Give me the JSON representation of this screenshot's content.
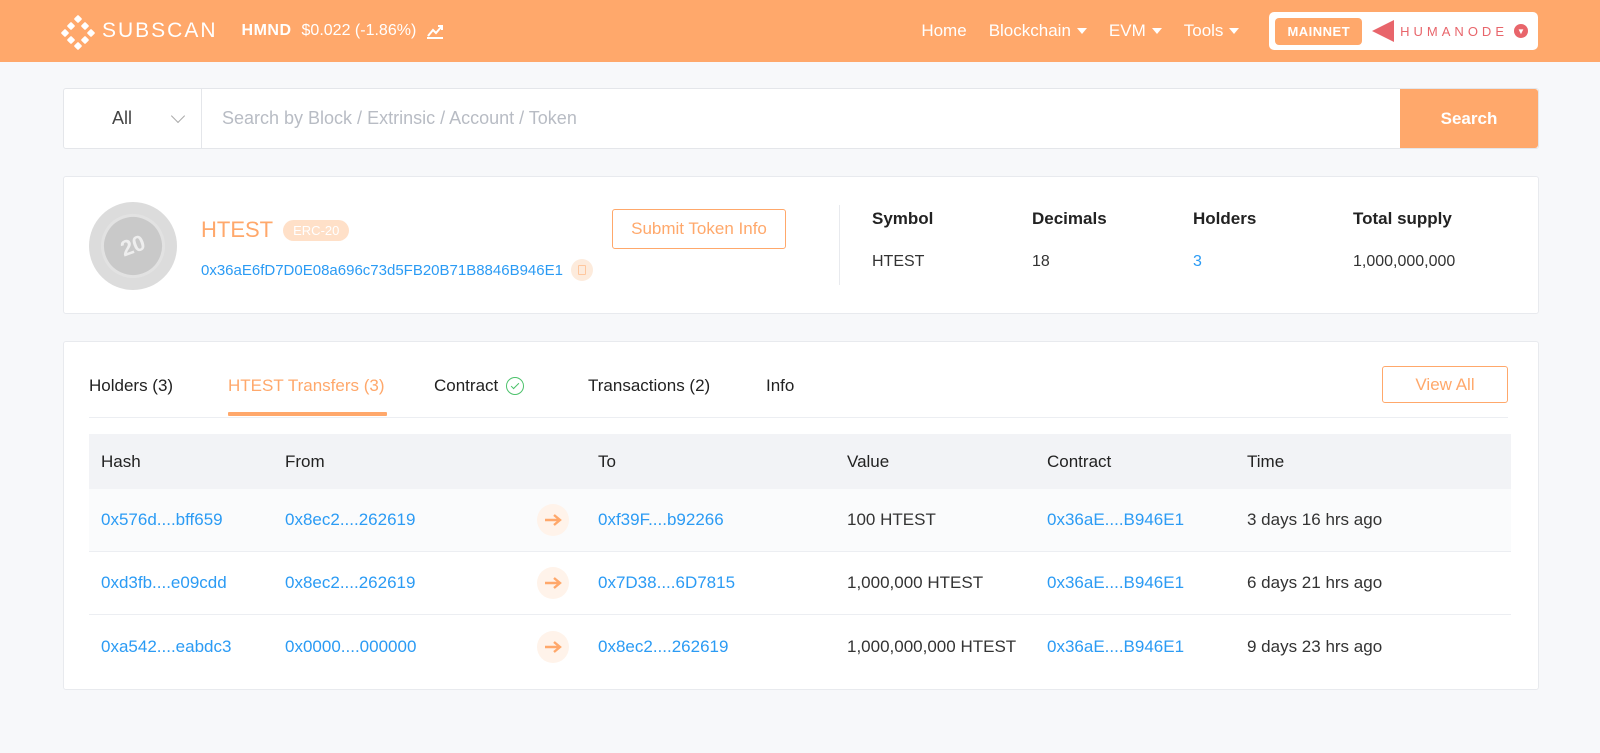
{
  "header": {
    "logo_text": "SUBSCAN",
    "token_symbol": "HMND",
    "token_price": "$0.022 (-1.86%)",
    "nav": [
      {
        "label": "Home"
      },
      {
        "label": "Blockchain"
      },
      {
        "label": "EVM"
      },
      {
        "label": "Tools"
      }
    ],
    "network_badge": "MAINNET",
    "network_name": "HUMANODE",
    "colors": {
      "accent": "#ffa86b",
      "link": "#2b9bf4"
    }
  },
  "search": {
    "select_value": "All",
    "placeholder": "Search by Block / Extrinsic / Account / Token",
    "button_label": "Search"
  },
  "token": {
    "name": "HTEST",
    "standard_badge": "ERC-20",
    "logo_text": "20",
    "address": "0x36aE6fD7D0E08a696c73d5FB20B71B8846B946E1",
    "submit_label": "Submit Token Info",
    "stats": {
      "symbol_label": "Symbol",
      "symbol": "HTEST",
      "decimals_label": "Decimals",
      "decimals": "18",
      "holders_label": "Holders",
      "holders": "3",
      "supply_label": "Total supply",
      "supply": "1,000,000,000"
    }
  },
  "tabs": {
    "holders": "Holders (3)",
    "transfers": "HTEST Transfers (3)",
    "contract": "Contract",
    "transactions": "Transactions (2)",
    "info": "Info",
    "view_all": "View All"
  },
  "table": {
    "headers": {
      "hash": "Hash",
      "from": "From",
      "to": "To",
      "value": "Value",
      "contract": "Contract",
      "time": "Time"
    },
    "rows": [
      {
        "hash": "0x576d....bff659",
        "from": "0x8ec2....262619",
        "to": "0xf39F....b92266",
        "value": "100",
        "unit": "HTEST",
        "contract": "0x36aE....B946E1",
        "time": "3 days 16 hrs ago"
      },
      {
        "hash": "0xd3fb....e09cdd",
        "from": "0x8ec2....262619",
        "to": "0x7D38....6D7815",
        "value": "1,000,000",
        "unit": "HTEST",
        "contract": "0x36aE....B946E1",
        "time": "6 days 21 hrs ago"
      },
      {
        "hash": "0xa542....eabdc3",
        "from": "0x0000....000000",
        "to": "0x8ec2....262619",
        "value": "1,000,000,000",
        "unit": "HTEST",
        "contract": "0x36aE....B946E1",
        "time": "9 days 23 hrs ago"
      }
    ]
  }
}
